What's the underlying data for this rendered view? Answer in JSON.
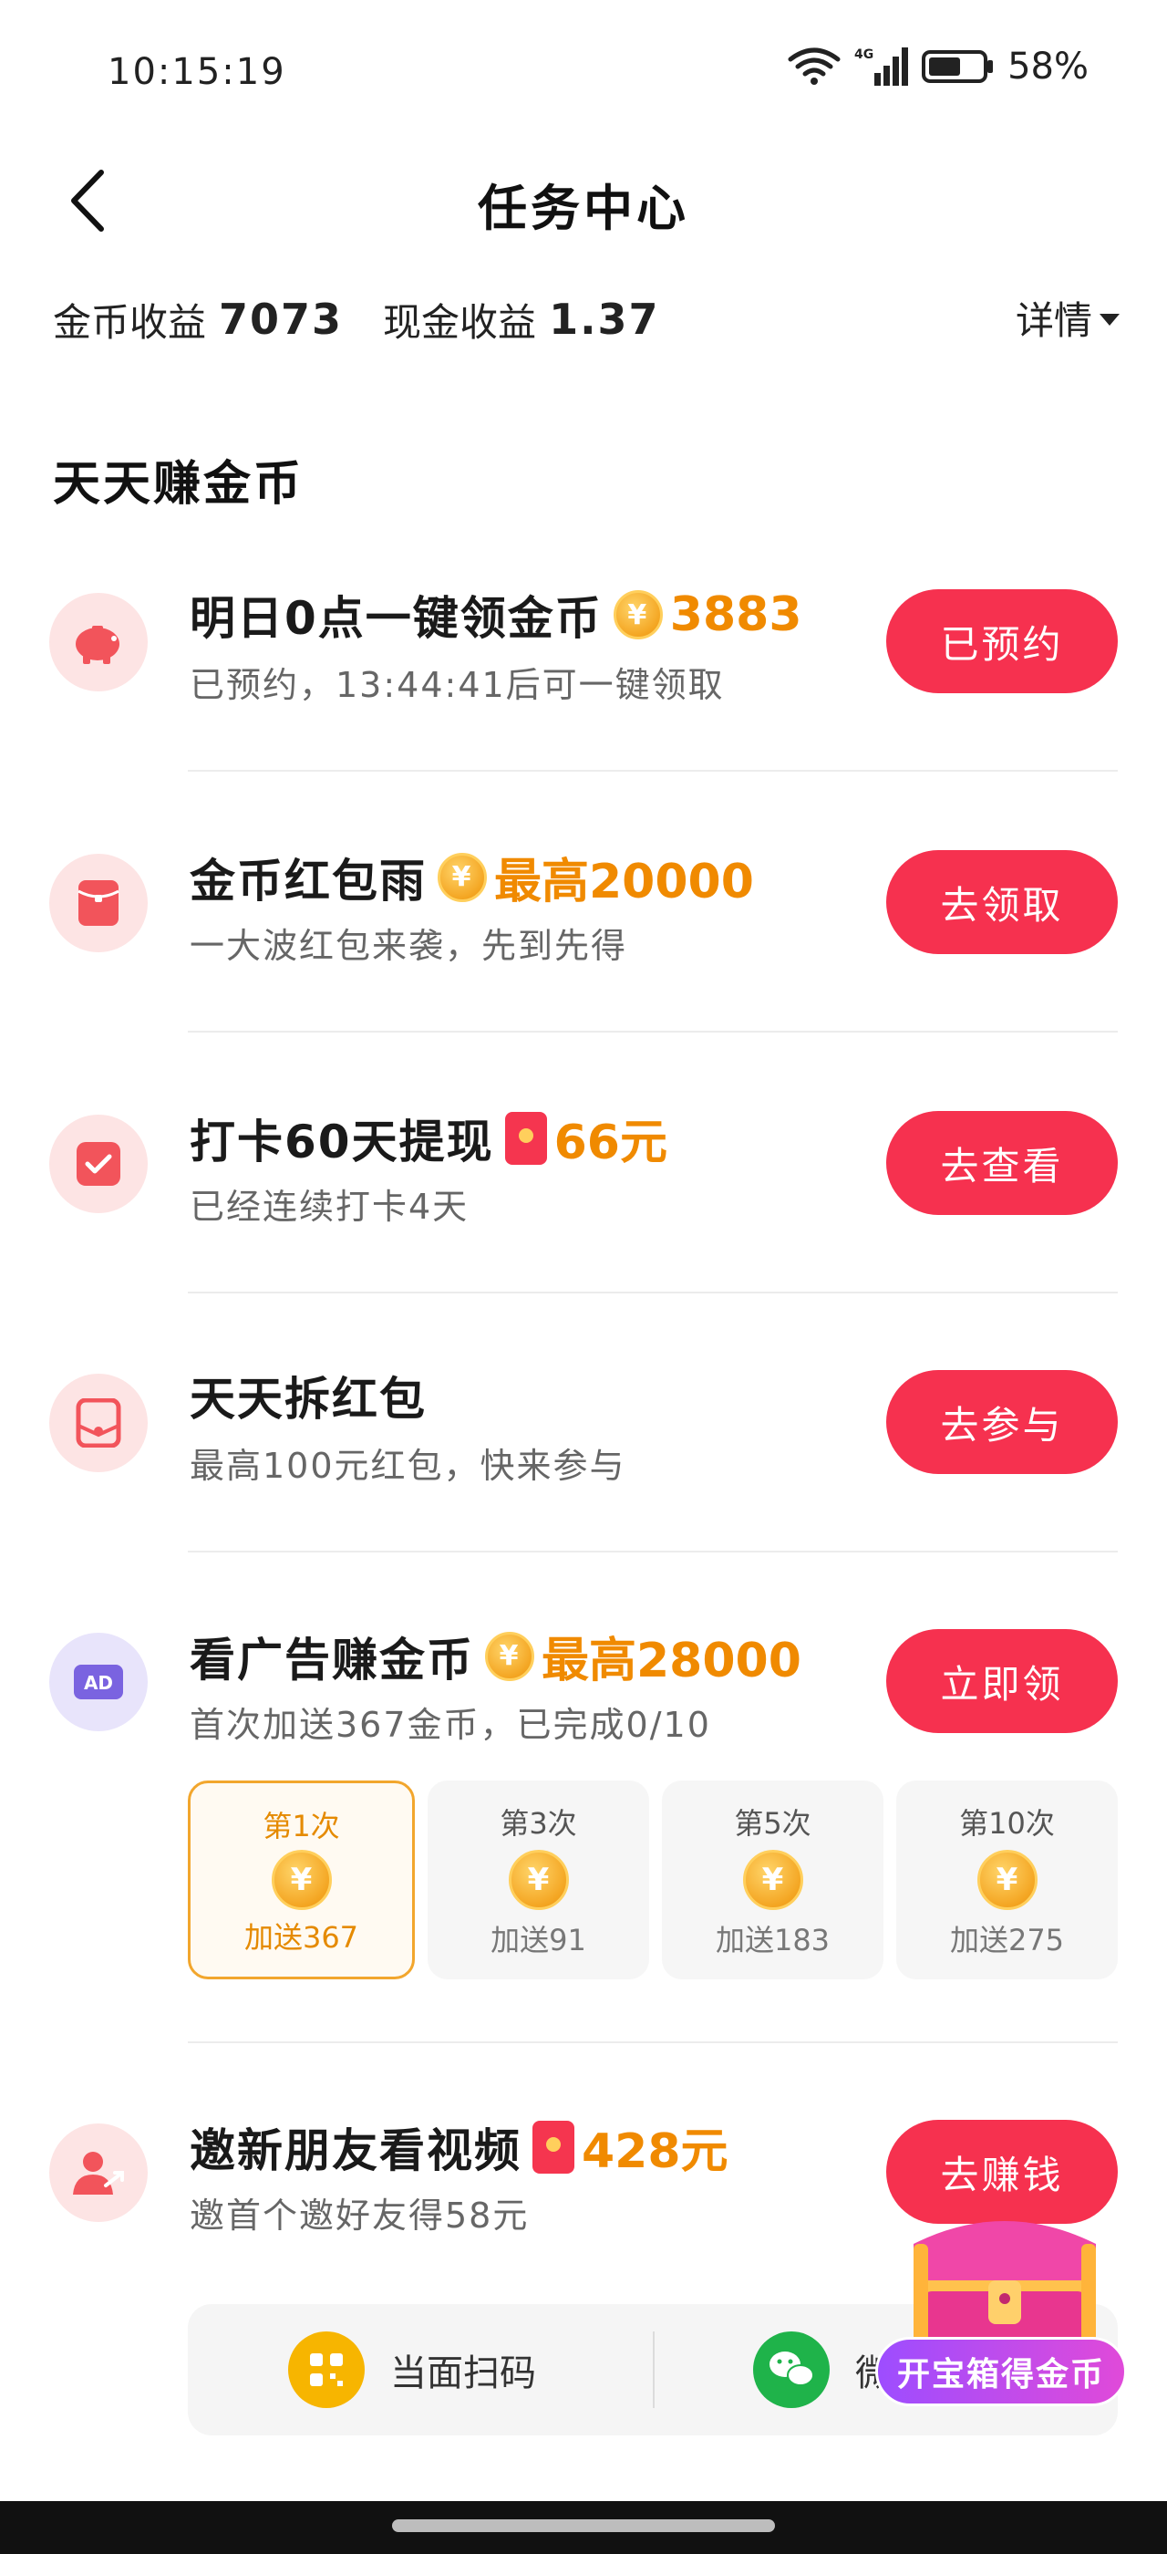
{
  "status_bar": {
    "time": "10:15:19",
    "battery_text": "58%",
    "network_label": "4G"
  },
  "header": {
    "title": "任务中心",
    "back_icon": "chevron-left-icon"
  },
  "earnings": {
    "coin_label": "金币收益",
    "coin_value": "7073",
    "cash_label": "现金收益",
    "cash_value": "1.37",
    "detail_label": "详情"
  },
  "section": {
    "title": "天天赚金币"
  },
  "tasks": [
    {
      "icon": "piggy-bank-icon",
      "title": "明日0点一键领金币",
      "reward_icon": "coin-icon",
      "reward": "3883",
      "subtitle": "已预约，13:44:41后可一键领取",
      "button": "已预约"
    },
    {
      "icon": "red-envelope-icon",
      "title": "金币红包雨",
      "reward_icon": "coin-icon",
      "reward": "最高20000",
      "subtitle": "一大波红包来袭，先到先得",
      "button": "去领取"
    },
    {
      "icon": "checkin-icon",
      "title": "打卡60天提现",
      "reward_icon": "red-packet-icon",
      "reward": "66元",
      "subtitle": "已经连续打卡4天",
      "button": "去查看"
    },
    {
      "icon": "open-envelope-icon",
      "title": "天天拆红包",
      "reward_icon": "",
      "reward": "",
      "subtitle": "最高100元红包，快来参与",
      "button": "去参与"
    },
    {
      "icon": "ad-icon",
      "title": "看广告赚金币",
      "reward_icon": "coin-icon",
      "reward": "最高28000",
      "subtitle": "首次加送367金币，已完成0/10",
      "button": "立即领"
    },
    {
      "icon": "invite-friends-icon",
      "title": "邀新朋友看视频",
      "reward_icon": "red-packet-icon",
      "reward": "428元",
      "subtitle": "邀首个邀好友得58元",
      "button": "去赚钱"
    }
  ],
  "ad_tiers": [
    {
      "label": "第1次",
      "bonus": "加送367",
      "active": true
    },
    {
      "label": "第3次",
      "bonus": "加送91",
      "active": false
    },
    {
      "label": "第5次",
      "bonus": "加送183",
      "active": false
    },
    {
      "label": "第10次",
      "bonus": "加送275",
      "active": false
    }
  ],
  "invite_options": {
    "scan_label": "当面扫码",
    "wechat_label": "微"
  },
  "treasure": {
    "label": "开宝箱得金币"
  },
  "colors": {
    "accent": "#f6314f",
    "reward": "#f08a00",
    "coin": "#f4a623"
  }
}
